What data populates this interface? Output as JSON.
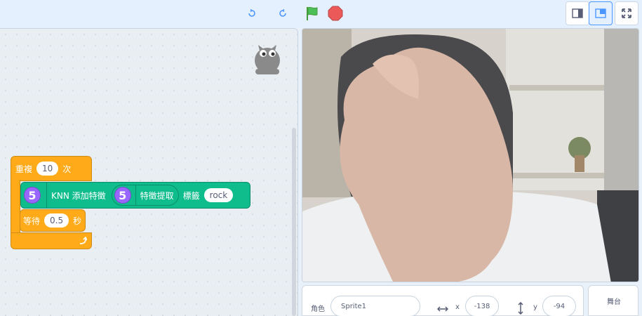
{
  "toolbar": {
    "undo_icon": "undo-icon",
    "redo_icon": "redo-icon",
    "green_flag_icon": "green-flag-icon",
    "stop_icon": "stop-icon",
    "layout_buttons": [
      "small-stage-icon",
      "normal-stage-icon",
      "fullscreen-icon"
    ]
  },
  "blocks": {
    "repeat": {
      "label": "重複",
      "count": "10",
      "suffix": "次"
    },
    "knn_add": {
      "number": "5",
      "label": "KNN 添加特徵",
      "inner_number": "5",
      "inner_label": "特徵提取",
      "tag_label": "標籤",
      "tag_value": "rock"
    },
    "wait": {
      "label": "等待",
      "seconds": "0.5",
      "suffix": "秒"
    }
  },
  "sprite_info": {
    "sprite_label": "角色",
    "sprite_name": "Sprite1",
    "x_label": "x",
    "x_value": "-138",
    "y_label": "y",
    "y_value": "-94"
  },
  "stage_panel": {
    "label": "舞台"
  },
  "colors": {
    "control": "#ffab19",
    "extension": "#0fbd8c",
    "reporter": "#9966ff",
    "flag": "#4cbf56",
    "stop": "#ec5959"
  }
}
